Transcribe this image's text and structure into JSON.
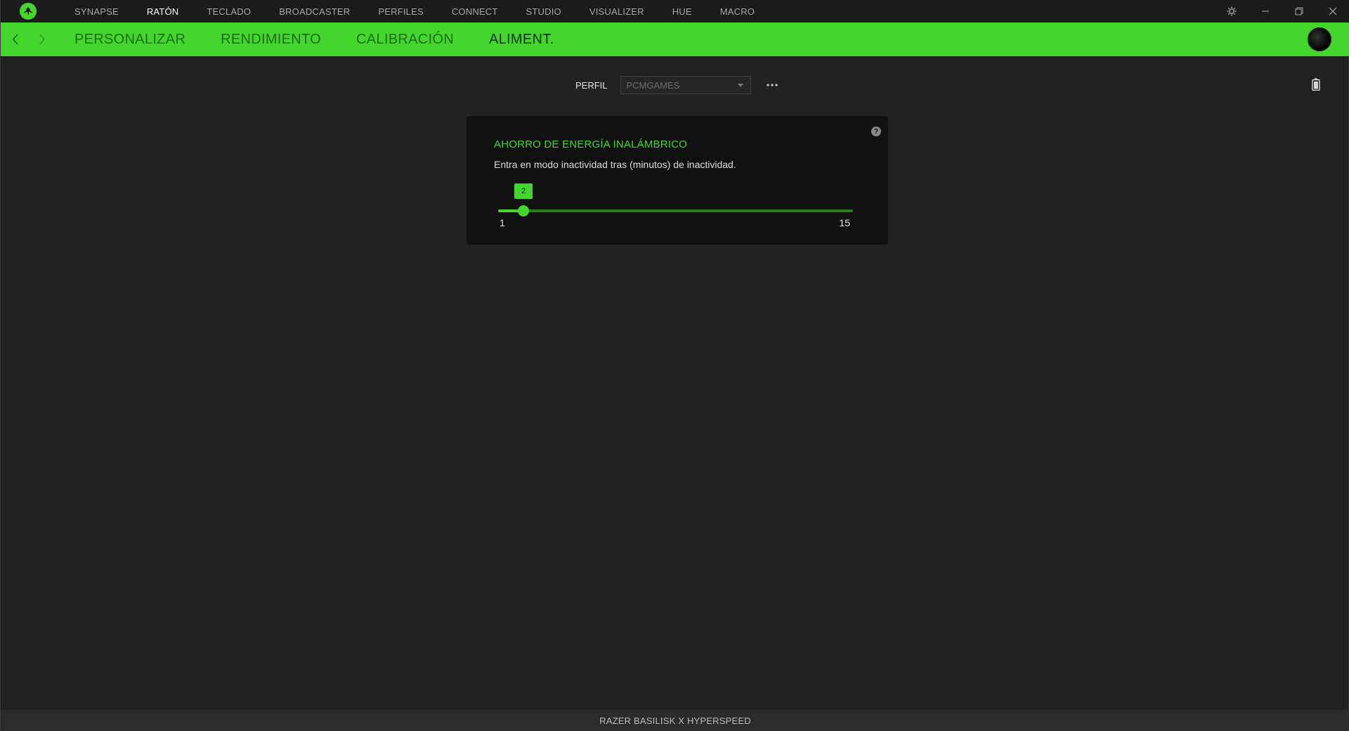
{
  "app": {
    "name": "Razer Synapse"
  },
  "topnav": {
    "items": [
      {
        "label": "SYNAPSE",
        "active": false
      },
      {
        "label": "RATÓN",
        "active": true
      },
      {
        "label": "TECLADO",
        "active": false
      },
      {
        "label": "BROADCASTER",
        "active": false
      },
      {
        "label": "PERFILES",
        "active": false
      },
      {
        "label": "CONNECT",
        "active": false
      },
      {
        "label": "STUDIO",
        "active": false
      },
      {
        "label": "VISUALIZER",
        "active": false
      },
      {
        "label": "HUE",
        "active": false
      },
      {
        "label": "MACRO",
        "active": false
      }
    ]
  },
  "subnav": {
    "tabs": [
      {
        "label": "PERSONALIZAR",
        "active": false
      },
      {
        "label": "RENDIMIENTO",
        "active": false
      },
      {
        "label": "CALIBRACIÓN",
        "active": false
      },
      {
        "label": "ALIMENT.",
        "active": true
      }
    ]
  },
  "profile": {
    "label": "PERFIL",
    "value": "PCMGAMES"
  },
  "panel": {
    "title": "AHORRO DE ENERGÍA INALÁMBRICO",
    "description": "Entra en modo inactividad tras (minutos) de inactividad.",
    "slider": {
      "min": 1,
      "max": 15,
      "value": 2,
      "min_label": "1",
      "max_label": "15",
      "value_label": "2"
    }
  },
  "status": {
    "device": "RAZER BASILISK X HYPERSPEED"
  },
  "colors": {
    "accent": "#44d62c",
    "background": "#222222",
    "panel": "#111111",
    "topbar": "#1b1b1b"
  }
}
